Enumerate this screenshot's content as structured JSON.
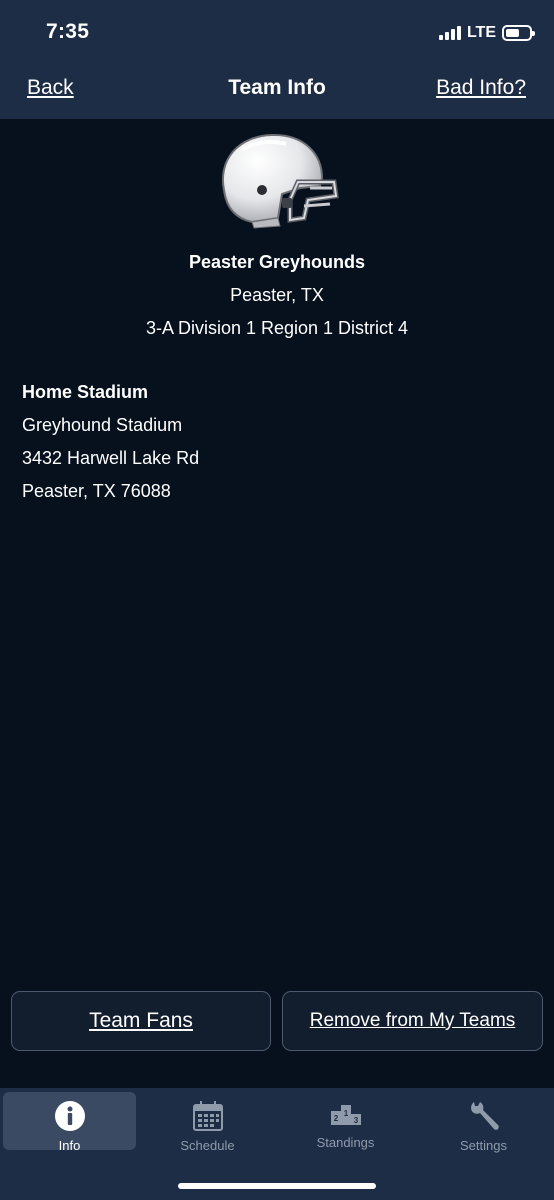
{
  "status": {
    "time": "7:35",
    "network": "LTE"
  },
  "nav": {
    "back_label": "Back",
    "title": "Team Info",
    "bad_info_label": "Bad Info?"
  },
  "team": {
    "name": "Peaster Greyhounds",
    "city": "Peaster, TX",
    "division": "3-A Division 1 Region 1 District 4"
  },
  "stadium": {
    "heading": "Home Stadium",
    "name": "Greyhound Stadium",
    "address": "3432 Harwell Lake Rd",
    "city_zip": "Peaster, TX 76088"
  },
  "actions": {
    "team_fans_label": "Team Fans",
    "remove_label": "Remove from My Teams"
  },
  "tabs": [
    {
      "label": "Info",
      "icon": "info-icon",
      "active": true
    },
    {
      "label": "Schedule",
      "icon": "calendar-icon",
      "active": false
    },
    {
      "label": "Standings",
      "icon": "podium-icon",
      "active": false
    },
    {
      "label": "Settings",
      "icon": "wrench-icon",
      "active": false
    }
  ],
  "colors": {
    "background": "#07101d",
    "bar": "#1e2d46",
    "active_tab": "#3a4a62",
    "inactive_label": "#8f9aab"
  }
}
